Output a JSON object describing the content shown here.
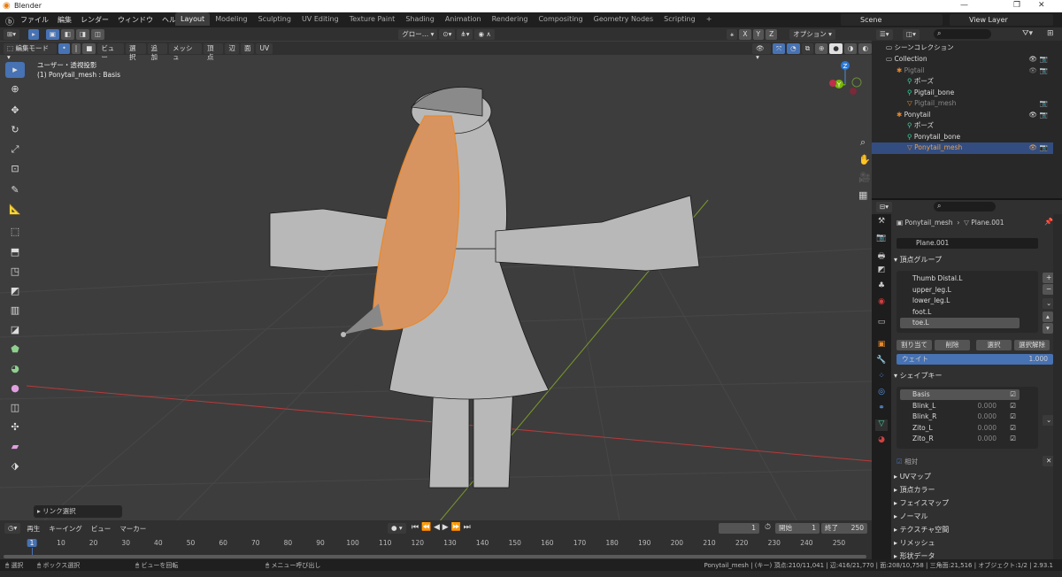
{
  "window": {
    "title": "Blender",
    "controls": [
      "—",
      "❐",
      "✕"
    ]
  },
  "menu": [
    "ファイル",
    "編集",
    "レンダー",
    "ウィンドウ",
    "ヘルプ"
  ],
  "workspaces": [
    {
      "label": "Layout",
      "active": true
    },
    {
      "label": "Modeling"
    },
    {
      "label": "Sculpting"
    },
    {
      "label": "UV Editing"
    },
    {
      "label": "Texture Paint"
    },
    {
      "label": "Shading"
    },
    {
      "label": "Animation"
    },
    {
      "label": "Rendering"
    },
    {
      "label": "Compositing"
    },
    {
      "label": "Geometry Nodes"
    },
    {
      "label": "Scripting"
    },
    {
      "label": "+"
    }
  ],
  "scene": {
    "name": "Scene",
    "view_layer": "View Layer"
  },
  "viewport": {
    "mode": "編集モード",
    "menus": [
      "ビュー",
      "選択",
      "追加",
      "メッシュ",
      "頂点",
      "辺",
      "面",
      "UV"
    ],
    "transform_orientation": "グロー…",
    "axes": [
      "X",
      "Y",
      "Z"
    ],
    "options": "オプション",
    "view_name": "ユーザー・透視投影",
    "object_info": "(1) Ponytail_mesh : Basis",
    "last_op": "リンク選択",
    "gizmo": {
      "z": "Z",
      "y": "Y"
    },
    "colors": {
      "mesh_selected": "#e8892c",
      "seam": "#2ad0d0",
      "x_axis": "#b83a3a",
      "y_axis": "#7a9a2a"
    }
  },
  "outliner": {
    "root": "シーンコレクション",
    "items": [
      {
        "label": "Collection",
        "depth": 0,
        "icon": "collection"
      },
      {
        "label": "Pigtail",
        "depth": 1,
        "icon": "armature",
        "dim": true
      },
      {
        "label": "ポーズ",
        "depth": 2,
        "icon": "pose"
      },
      {
        "label": "Pigtail_bone",
        "depth": 2,
        "icon": "armature-data"
      },
      {
        "label": "Pigtail_mesh",
        "depth": 2,
        "icon": "mesh",
        "dim": true
      },
      {
        "label": "Ponytail",
        "depth": 1,
        "icon": "armature"
      },
      {
        "label": "ポーズ",
        "depth": 2,
        "icon": "pose"
      },
      {
        "label": "Ponytail_bone",
        "depth": 2,
        "icon": "armature-data"
      },
      {
        "label": "Ponytail_mesh",
        "depth": 2,
        "icon": "mesh",
        "selected": true
      }
    ]
  },
  "properties": {
    "breadcrumb": {
      "object": "Ponytail_mesh",
      "data": "Plane.001"
    },
    "mesh_name": "Plane.001",
    "vertex_groups": {
      "title": "頂点グループ",
      "items": [
        "Thumb Distal.L",
        "upper_leg.L",
        "lower_leg.L",
        "foot.L",
        "toe.L"
      ],
      "selected": "toe.L",
      "assign": "割り当て",
      "remove": "削除",
      "select": "選択",
      "deselect": "選択解除",
      "weight_label": "ウェイト",
      "weight": "1.000"
    },
    "shape_keys": {
      "title": "シェイプキー",
      "items": [
        {
          "name": "Basis",
          "value": ""
        },
        {
          "name": "Blink_L",
          "value": "0.000"
        },
        {
          "name": "Blink_R",
          "value": "0.000"
        },
        {
          "name": "Zito_L",
          "value": "0.000"
        },
        {
          "name": "Zito_R",
          "value": "0.000"
        }
      ],
      "relative": "相対"
    },
    "panels": [
      "UVマップ",
      "頂点カラー",
      "フェイスマップ",
      "ノーマル",
      "テクスチャ空間",
      "リメッシュ",
      "形状データ"
    ]
  },
  "timeline": {
    "menus": [
      "再生",
      "キーイング",
      "ビュー",
      "マーカー"
    ],
    "current_frame": "1",
    "start_label": "開始",
    "start": "1",
    "end_label": "終了",
    "end": "250",
    "ticks": [
      "1",
      "10",
      "20",
      "30",
      "40",
      "50",
      "60",
      "70",
      "80",
      "90",
      "100",
      "110",
      "120",
      "130",
      "140",
      "150",
      "160",
      "170",
      "180",
      "190",
      "200",
      "210",
      "220",
      "230",
      "240",
      "250"
    ]
  },
  "status": {
    "select": "選択",
    "box_select": "ボックス選択",
    "rotate_view": "ビューを回転",
    "call_menu": "メニュー呼び出し",
    "stats": "Ponytail_mesh | (キー) 頂点:210/11,041 | 辺:416/21,770 | 面:208/10,758 | 三角面:21,516 | オブジェクト:1/2 | 2.93.1"
  }
}
